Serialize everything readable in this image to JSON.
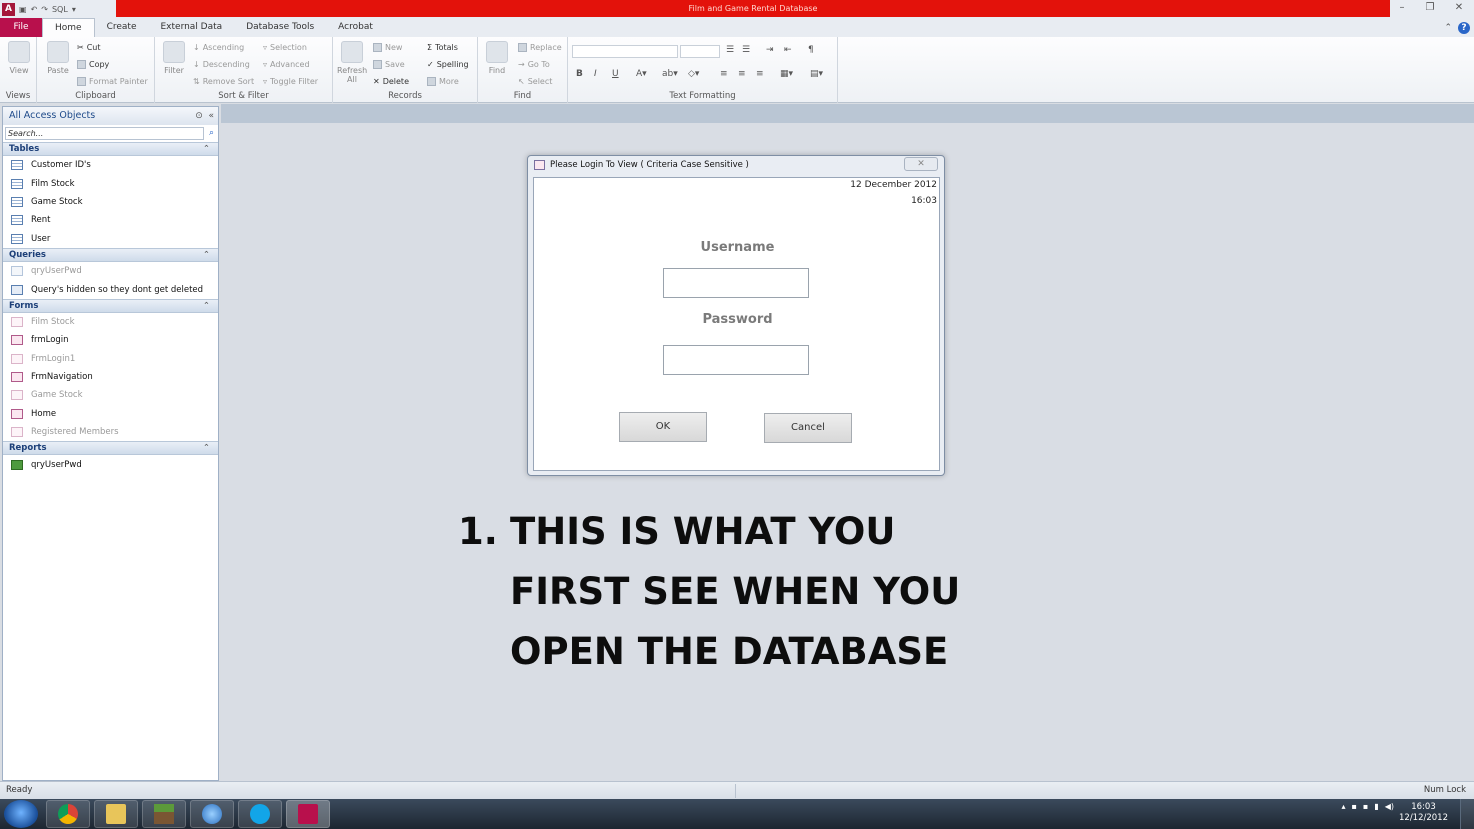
{
  "window": {
    "title": "Film and Game Rental Database",
    "app_icon_letter": "A",
    "qat_text": "SQL",
    "controls": [
      "–",
      "❐",
      "✕"
    ]
  },
  "tabs": [
    "File",
    "Home",
    "Create",
    "External Data",
    "Database Tools",
    "Acrobat"
  ],
  "active_tab": "Home",
  "ribbon": {
    "views": {
      "view_label": "View",
      "group": "Views"
    },
    "clipboard": {
      "paste_label": "Paste",
      "cut": "Cut",
      "copy": "Copy",
      "format_painter": "Format Painter",
      "group": "Clipboard"
    },
    "sort_filter": {
      "filter_label": "Filter",
      "ascending": "Ascending",
      "descending": "Descending",
      "remove_sort": "Remove Sort",
      "selection": "Selection",
      "advanced": "Advanced",
      "toggle_filter": "Toggle Filter",
      "group": "Sort & Filter"
    },
    "records": {
      "refresh_label": "Refresh",
      "refresh_sub": "All",
      "new": "New",
      "save": "Save",
      "delete": "Delete",
      "totals": "Totals",
      "spelling": "Spelling",
      "more": "More",
      "group": "Records"
    },
    "find": {
      "find_label": "Find",
      "replace": "Replace",
      "go_to": "Go To",
      "select": "Select",
      "group": "Find"
    },
    "text_formatting": {
      "group": "Text Formatting",
      "bold": "B",
      "italic": "I",
      "underline": "U"
    }
  },
  "nav": {
    "header": "All Access Objects",
    "search_placeholder": "Search...",
    "categories": [
      {
        "name": "Tables",
        "items": [
          {
            "label": "Customer ID's",
            "dim": false
          },
          {
            "label": "Film Stock",
            "dim": false
          },
          {
            "label": "Game Stock",
            "dim": false
          },
          {
            "label": "Rent",
            "dim": false
          },
          {
            "label": "User",
            "dim": false
          }
        ]
      },
      {
        "name": "Queries",
        "items": [
          {
            "label": "qryUserPwd",
            "dim": true
          },
          {
            "label": "Query's hidden so they dont get deleted",
            "dim": false
          }
        ]
      },
      {
        "name": "Forms",
        "items": [
          {
            "label": "Film Stock",
            "dim": true
          },
          {
            "label": "frmLogin",
            "dim": false
          },
          {
            "label": "FrmLogin1",
            "dim": true
          },
          {
            "label": "FrmNavigation",
            "dim": false
          },
          {
            "label": "Game Stock",
            "dim": true
          },
          {
            "label": "Home",
            "dim": false
          },
          {
            "label": "Registered Members",
            "dim": true
          }
        ]
      },
      {
        "name": "Reports",
        "items": [
          {
            "label": "qryUserPwd",
            "dim": false
          }
        ]
      }
    ]
  },
  "dialog": {
    "title": "Please Login To View ( Criteria Case Sensitive )",
    "date": "12 December 2012",
    "time": "16:03",
    "username_label": "Username",
    "password_label": "Password",
    "username_value": "",
    "password_value": "",
    "ok": "OK",
    "cancel": "Cancel"
  },
  "annotation": {
    "number": "1.",
    "lines": [
      "THIS IS WHAT YOU",
      "FIRST SEE WHEN YOU",
      "OPEN THE DATABASE"
    ]
  },
  "status": {
    "left": "Ready",
    "right": "Num Lock"
  },
  "taskbar": {
    "apps": [
      "chrome-icon",
      "explorer-icon",
      "minecraft-icon",
      "itunes-icon",
      "skype-icon",
      "access-icon"
    ],
    "clock_time": "16:03",
    "clock_date": "12/12/2012"
  },
  "colors": {
    "title_red": "#e3120b",
    "file_tab": "#b8104c",
    "nav_blue": "#1e4a8a"
  }
}
